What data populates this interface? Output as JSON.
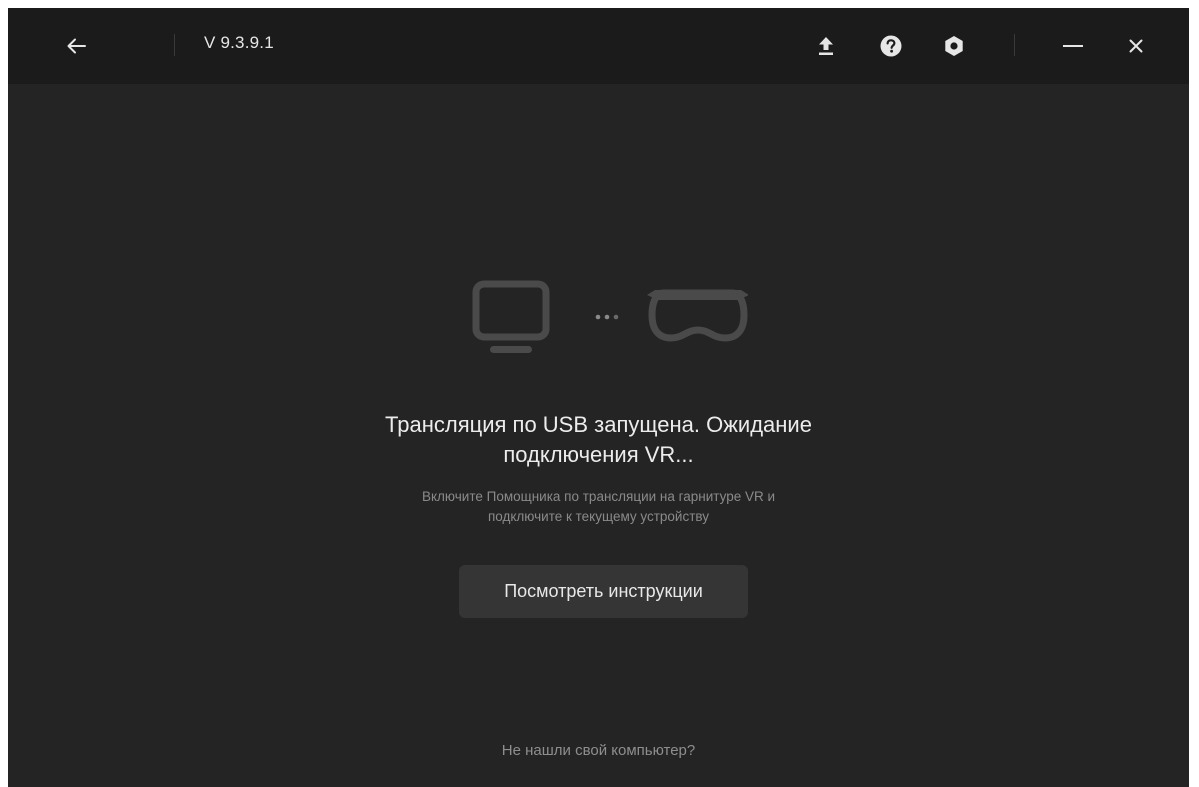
{
  "titlebar": {
    "version": "V 9.3.9.1",
    "icons": {
      "back": "arrow-left-icon",
      "upload": "upload-icon",
      "help": "help-icon",
      "settings": "gear-icon",
      "minimize": "minimize-icon",
      "close": "close-icon"
    }
  },
  "main": {
    "title_line1": "Трансляция по USB запущена. Ожидание",
    "title_line2": "подключения VR...",
    "subtitle_line1": "Включите Помощника по трансляции на гарнитуре VR и",
    "subtitle_line2": "подключите к текущему устройству",
    "instructions_button": "Посмотреть инструкции",
    "not_found_link": "Не нашли свой компьютер?"
  },
  "colors": {
    "window_bg": "#242424",
    "titlebar_bg": "#1b1b1b",
    "illustration": "#4a4a4a",
    "button_bg": "#353535"
  }
}
